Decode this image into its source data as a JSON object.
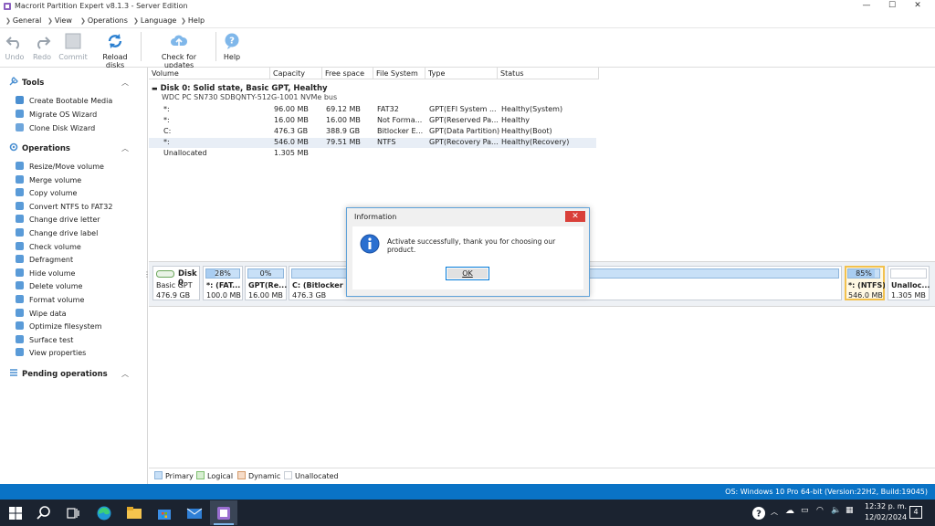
{
  "window": {
    "title": "Macrorit Partition Expert v8.1.3 - Server Edition",
    "minimize": "—",
    "maximize": "☐",
    "close": "✕"
  },
  "menu": [
    {
      "label": "General"
    },
    {
      "label": "View"
    },
    {
      "label": "Operations"
    },
    {
      "label": "Language"
    },
    {
      "label": "Help"
    }
  ],
  "toolbar": {
    "undo": "Undo",
    "redo": "Redo",
    "commit": "Commit",
    "reload": "Reload disks",
    "check_updates": "Check for updates",
    "help": "Help"
  },
  "sidebar": {
    "tools_title": "Tools",
    "tools": [
      "Create Bootable Media",
      "Migrate OS Wizard",
      "Clone Disk Wizard"
    ],
    "operations_title": "Operations",
    "operations": [
      "Resize/Move volume",
      "Merge volume",
      "Copy volume",
      "Convert NTFS to FAT32",
      "Change drive letter",
      "Change drive label",
      "Check volume",
      "Defragment",
      "Hide volume",
      "Delete volume",
      "Format volume",
      "Wipe data",
      "Optimize filesystem",
      "Surface test",
      "View properties"
    ],
    "pending_title": "Pending operations"
  },
  "table": {
    "headers": [
      "Volume",
      "Capacity",
      "Free space",
      "File System",
      "Type",
      "Status"
    ],
    "disk_title": "Disk 0: Solid state, Basic GPT, Healthy",
    "disk_model": "WDC PC SN730 SDBQNTY-512G-1001 NVMe bus",
    "rows": [
      {
        "volume": "*:",
        "capacity": "96.00 MB",
        "free": "69.12 MB",
        "fs": "FAT32",
        "type": "GPT(EFI System ...",
        "status": "Healthy(System)"
      },
      {
        "volume": "*:",
        "capacity": "16.00 MB",
        "free": "16.00 MB",
        "fs": "Not Forma...",
        "type": "GPT(Reserved Pa...",
        "status": "Healthy"
      },
      {
        "volume": "C:",
        "capacity": "476.3 GB",
        "free": "388.9 GB",
        "fs": "Bitlocker E...",
        "type": "GPT(Data Partition)",
        "status": "Healthy(Boot)"
      },
      {
        "volume": "*:",
        "capacity": "546.0 MB",
        "free": "79.51 MB",
        "fs": "NTFS",
        "type": "GPT(Recovery Pa...",
        "status": "Healthy(Recovery)"
      },
      {
        "volume": "Unallocated",
        "capacity": "1.305 MB",
        "free": "",
        "fs": "",
        "type": "",
        "status": ""
      }
    ]
  },
  "diskmap": {
    "disk": {
      "name": "Disk 0",
      "type": "Basic GPT",
      "size": "476.9 GB"
    },
    "parts": [
      {
        "pct": "28%",
        "label": "*: (FAT...",
        "size": "100.0 MB",
        "fill": 0.28
      },
      {
        "pct": "0%",
        "label": "GPT(Re...",
        "size": "16.00 MB",
        "fill": 0.0
      },
      {
        "pct": "",
        "label": "C: (Bitlocker En",
        "size": "476.3 GB",
        "fill": 1.0
      },
      {
        "pct": "85%",
        "label": "*: (NTFS)",
        "size": "546.0 MB",
        "fill": 0.85
      },
      {
        "pct": "",
        "label": "Unalloc...",
        "size": "1.305 MB",
        "fill": 0.0
      }
    ]
  },
  "legend": [
    "Primary",
    "Logical",
    "Dynamic",
    "Unallocated"
  ],
  "status": "OS: Windows 10 Pro 64-bit (Version:22H2, Build:19045)",
  "dialog": {
    "title": "Information",
    "message": "Activate successfully, thank you for choosing our product.",
    "ok": "OK"
  },
  "taskbar": {
    "time": "12:32 p. m.",
    "date": "12/02/2024",
    "notifications": "4"
  },
  "colors": {
    "accent": "#0a73c6",
    "primary_fill": "#c8e0f7",
    "selected_part_border": "#f2c14e",
    "close_red": "#d9403a"
  }
}
